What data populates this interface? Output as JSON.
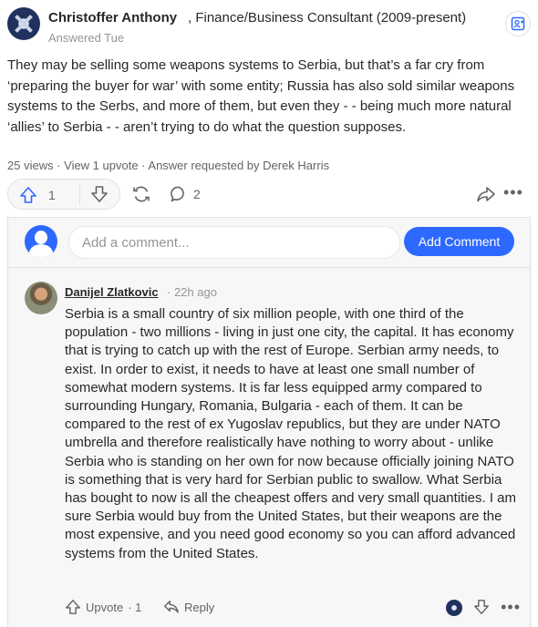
{
  "answer": {
    "author_name": "Christoffer Anthony",
    "author_credential": ", Finance/Business Consultant (2009-present)",
    "answered": "Answered Tue",
    "text": "They may be selling some weapons systems to Serbia, but that’s a far cry from ‘preparing the buyer for war’ with some entity; Russia has also sold similar weapons systems to the Serbs, and more of them, but even they - - being much more natural ‘allies’ to Serbia - - aren’t trying to do what the question supposes.",
    "meta": "25 views · View 1 upvote · Answer requested by Derek Harris"
  },
  "actions": {
    "upvote_count": "1",
    "comment_count": "2",
    "icons": [
      "upvote-icon",
      "downvote-icon",
      "share-icon",
      "comment-icon",
      "forward-icon",
      "more-icon"
    ]
  },
  "add_comment": {
    "placeholder": "Add a comment...",
    "button_label": "Add Comment"
  },
  "comment": {
    "author": "Danijel Zlatkovic",
    "time": " · 22h ago",
    "text": "Serbia is a small country of six million people, with one third of the population - two millions - living in just one city, the capital. It has economy that is trying to catch up with the rest of Europe. Serbian army needs, to exist. In order to exist, it needs to have at least one small number of somewhat modern systems. It is far less equipped army compared to surrounding Hungary, Romania, Bulgaria - each of them. It can be compared to the rest of ex Yugoslav republics, but they are under NATO umbrella and therefore realistically have nothing to worry about - unlike Serbia who is standing on her own for now because officially joining NATO is something that is very hard for Serbian public to swallow. What Serbia has bought to now is all the cheapest offers and very small quantities. I am sure Serbia would buy from the United States, but their weapons are the most expensive, and you need good economy so you can afford advanced systems from the United States.",
    "upvote_label": "Upvote",
    "upvote_count": "· 1",
    "reply_label": "Reply"
  },
  "colors": {
    "accent": "#2e69ff",
    "text": "#282829",
    "muted": "#939598",
    "border": "#dee0e1"
  }
}
